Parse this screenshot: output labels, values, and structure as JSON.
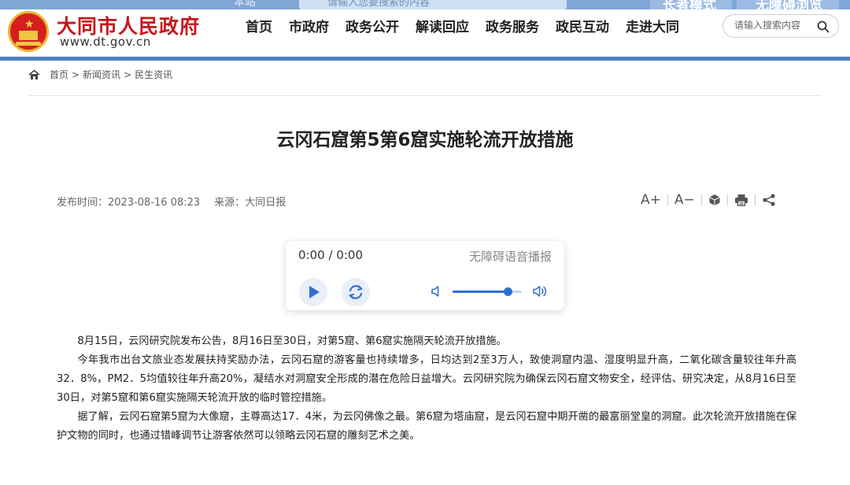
{
  "topbar": {
    "site_scope": "本站",
    "search_placeholder": "请输入您要搜索的内容",
    "long_mode": "长者模式",
    "accessible": "无障碍浏览"
  },
  "header": {
    "site_title": "大同市人民政府",
    "site_url": "www.dt.gov.cn",
    "nav": [
      "首页",
      "市政府",
      "政务公开",
      "解读回应",
      "政务服务",
      "政民互动",
      "走进大同"
    ],
    "search_placeholder": "请输入搜索内容",
    "brand_color": "#c8161d",
    "accent_color": "#4f7fc0"
  },
  "breadcrumb": [
    "首页",
    "新闻资讯",
    "民生资讯"
  ],
  "article": {
    "title": "云冈石窟第5第6窟实施轮流开放措施",
    "publish_label": "发布时间：",
    "publish_time": "2023-08-16 08:23",
    "source_label": "来源：",
    "source": "大同日报",
    "tools": {
      "font_increase": "A+",
      "font_decrease": "A−",
      "icons": [
        "cube-icon",
        "print-icon",
        "share-icon"
      ]
    },
    "paragraphs": [
      "8月15日，云冈研究院发布公告，8月16日至30日，对第5窟、第6窟实施隔天轮流开放措施。",
      "今年我市出台文旅业态发展扶持奖励办法，云冈石窟的游客量也持续增多，日均达到2至3万人，致使洞窟内温、湿度明显升高，二氧化碳含量较往年升高32．8%，PM2．5均值较往年升高20%，凝结水对洞窟安全形成的潜在危险日益增大。云冈研究院为确保云冈石窟文物安全，经评估、研究决定，从8月16日至30日，对第5窟和第6窟实施隔天轮流开放的临时管控措施。",
      "据了解，云冈石窟第5窟为大像窟，主尊高达17．4米，为云冈佛像之最。第6窟为塔庙窟，是云冈石窟中期开凿的最富丽堂皇的洞窟。此次轮流开放措施在保护文物的同时，也通过错峰调节让游客依然可以领略云冈石窟的雕刻艺术之美。"
    ]
  },
  "player": {
    "current_time": "0:00",
    "separator": "/",
    "duration": "0:00",
    "label": "无障碍语音播报",
    "volume_fraction": 0.8,
    "accent_color": "#2f6fd0"
  }
}
